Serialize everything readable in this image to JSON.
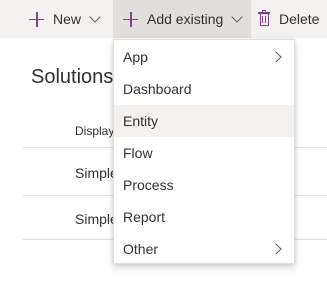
{
  "toolbar": {
    "new_label": "New",
    "add_existing_label": "Add existing",
    "delete_label": "Delete",
    "accent_color": "#8a3c91"
  },
  "page": {
    "title": "Solutions",
    "column_header": "Display",
    "rows": [
      "Simple",
      "Simple"
    ]
  },
  "menu": {
    "items": [
      {
        "label": "App",
        "submenu": true
      },
      {
        "label": "Dashboard",
        "submenu": false
      },
      {
        "label": "Entity",
        "submenu": false,
        "highlighted": true
      },
      {
        "label": "Flow",
        "submenu": false
      },
      {
        "label": "Process",
        "submenu": false
      },
      {
        "label": "Report",
        "submenu": false
      },
      {
        "label": "Other",
        "submenu": true
      }
    ]
  },
  "icons": [
    "plus-icon",
    "chevron-down-icon",
    "trash-icon",
    "chevron-right-icon"
  ]
}
